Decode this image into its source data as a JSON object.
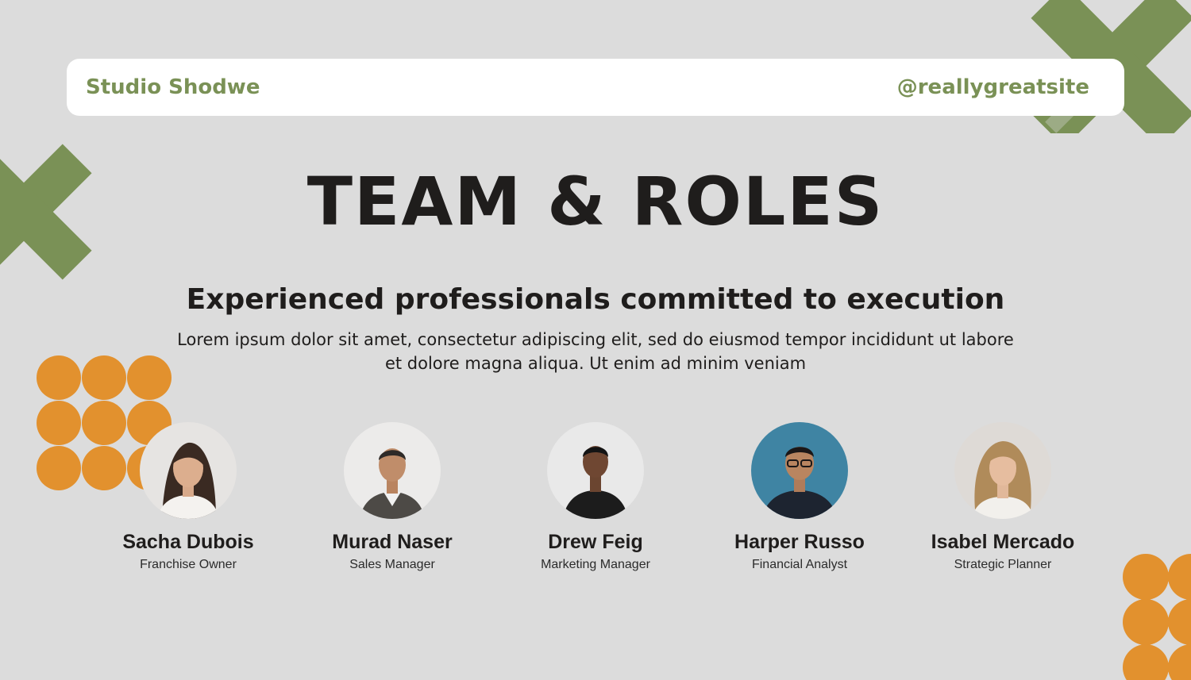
{
  "header": {
    "brand": "Studio Shodwe",
    "website": "@reallygreatsite"
  },
  "title": "TEAM & ROLES",
  "subtitle": "Experienced professionals committed to execution",
  "body_text": "Lorem ipsum dolor sit amet, consectetur adipiscing elit, sed do eiusmod tempor incididunt ut labore et dolore magna aliqua. Ut enim ad minim veniam",
  "team": [
    {
      "name": "Sacha Dubois",
      "role": "Franchise Owner"
    },
    {
      "name": "Murad Naser",
      "role": "Sales Manager"
    },
    {
      "name": "Drew Feig",
      "role": "Marketing Manager"
    },
    {
      "name": "Harper Russo",
      "role": "Financial Analyst"
    },
    {
      "name": "Isabel Mercado",
      "role": "Strategic Planner"
    }
  ],
  "colors": {
    "background": "#dcdcdc",
    "accent_green": "#7a9156",
    "accent_orange": "#e2912e",
    "text": "#1f1d1c"
  }
}
